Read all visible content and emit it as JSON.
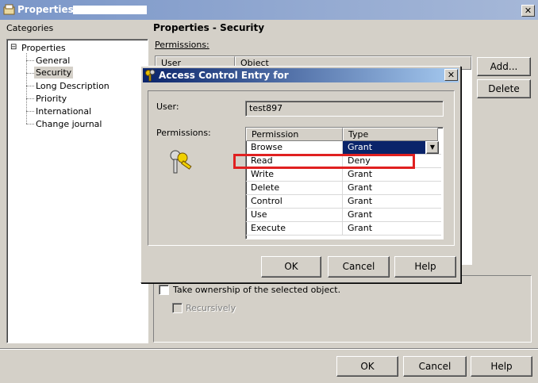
{
  "window": {
    "title": "Properties -",
    "close_glyph": "✕"
  },
  "categories": {
    "label": "Categories",
    "root": {
      "expander": "⊟",
      "label": "Properties"
    },
    "items": [
      "General",
      "Security",
      "Long Description",
      "Priority",
      "International",
      "Change journal"
    ],
    "selected": "Security"
  },
  "panel": {
    "title": "Properties - Security",
    "permissions_label": "Permissions:",
    "list_headers": [
      "User",
      "Object"
    ],
    "add_button": "Add...",
    "delete_button": "Delete",
    "take_ownership_label": "Take ownership of the selected object.",
    "recursively_label": "Recursively"
  },
  "footer": {
    "ok": "OK",
    "cancel": "Cancel",
    "help": "Help"
  },
  "dialog": {
    "title": "Access Control Entry for",
    "close_glyph": "✕",
    "user_label": "User:",
    "user_value": "test897",
    "permissions_label": "Permissions:",
    "columns": [
      "Permission",
      "Type"
    ],
    "rows": [
      {
        "permission": "Browse",
        "type": "Grant"
      },
      {
        "permission": "Read",
        "type": "Deny"
      },
      {
        "permission": "Write",
        "type": "Grant"
      },
      {
        "permission": "Delete",
        "type": "Grant"
      },
      {
        "permission": "Control",
        "type": "Grant"
      },
      {
        "permission": "Use",
        "type": "Grant"
      },
      {
        "permission": "Execute",
        "type": "Grant"
      }
    ],
    "dropdown_arrow": "▼",
    "ok": "OK",
    "cancel": "Cancel",
    "help": "Help"
  },
  "colors": {
    "title_active": "#0a246a",
    "title_inactive": "#7a96c8",
    "highlight_box": "#e02020"
  },
  "icons": {
    "window": "properties-icon",
    "dialog": "keys-icon",
    "permissions": "keys-icon"
  }
}
